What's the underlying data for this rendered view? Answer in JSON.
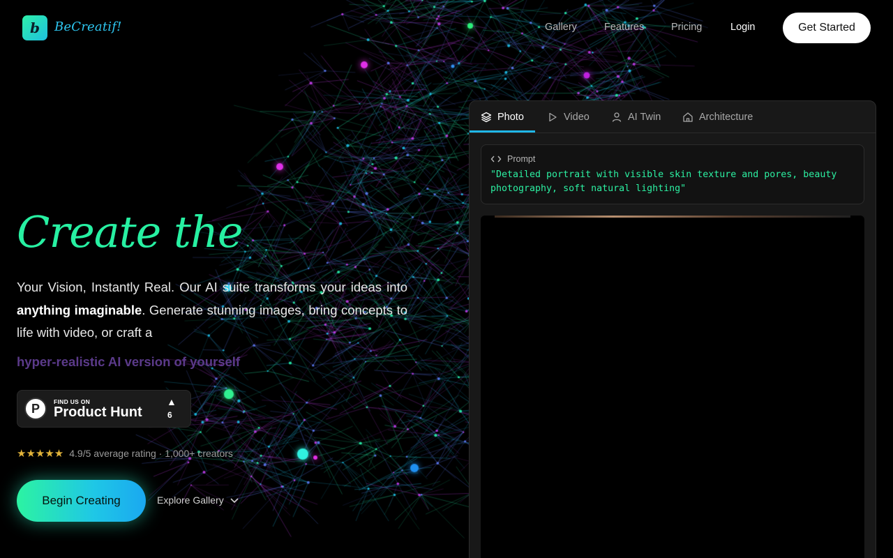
{
  "nav": {
    "brand_letter": "b",
    "brand_name": "BeCreatif!",
    "links": [
      "Gallery",
      "Features",
      "Pricing"
    ],
    "login_label": "Login",
    "cta_label": "Get Started"
  },
  "hero": {
    "title": "Create the",
    "desc_part1": "Your Vision, Instantly Real. Our AI suite transforms your ideas into ",
    "desc_bold": "anything imaginable",
    "desc_part2": ". Generate stunning images, bring concepts to life with video, or craft a",
    "highlight": "hyper-realistic AI version of yourself"
  },
  "product_hunt": {
    "small_text": "FIND US ON",
    "big_text": "Product Hunt",
    "logo_letter": "P",
    "upvotes": "6"
  },
  "rating": {
    "stars": "★★★★★",
    "text": "4.9/5 average rating · 1,000+ creators"
  },
  "actions": {
    "begin_label": "Begin Creating",
    "explore_label": "Explore Gallery"
  },
  "panel": {
    "tabs": [
      {
        "label": "Photo",
        "icon": "layers-icon"
      },
      {
        "label": "Video",
        "icon": "play-icon"
      },
      {
        "label": "AI Twin",
        "icon": "user-icon"
      },
      {
        "label": "Architecture",
        "icon": "home-icon"
      }
    ],
    "active_tab": "Photo",
    "prompt_label": "Prompt",
    "prompt_text": "\"Detailed portrait with visible skin texture and pores, beauty photography, soft natural lighting\""
  },
  "colors": {
    "accent_green": "#27f0a2",
    "accent_cyan": "#1fb7e8",
    "highlight_purple": "#5b3a8a",
    "star_gold": "#e3b43a"
  }
}
